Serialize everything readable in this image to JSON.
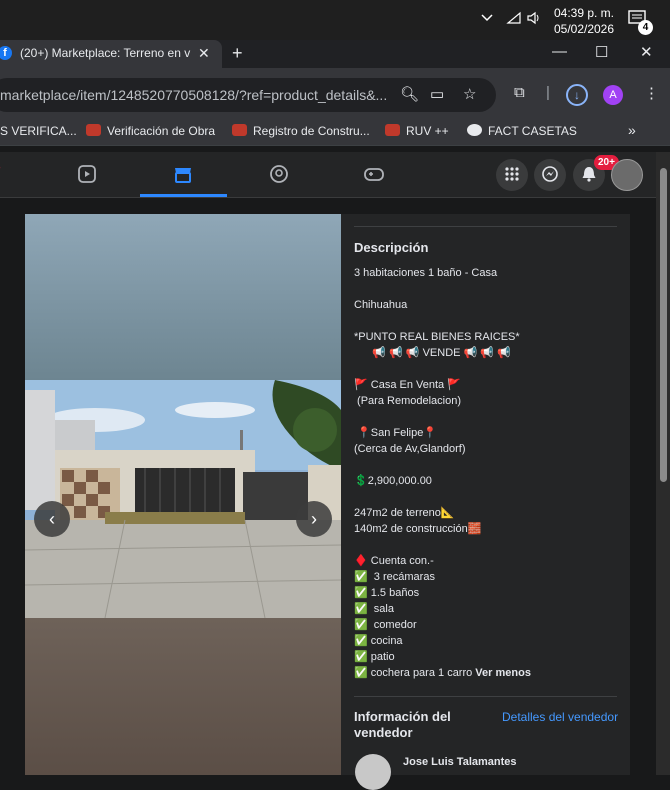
{
  "taskbar": {
    "time": "04:39 p. m.",
    "date": "05/02/2026",
    "notification_count": "4"
  },
  "browser": {
    "tab_title": "(20+) Marketplace: Terreno en v",
    "url": "marketplace/item/1248520770508128/?ref=product_details&...",
    "profile_initial": "A",
    "bookmarks": [
      "S VERIFICA...",
      "Verificación de Obra",
      "Registro de Constru...",
      "RUV ++",
      "FACT CASETAS"
    ]
  },
  "facebook": {
    "notification_badge": "20+"
  },
  "listing": {
    "description_title": "Descripción",
    "description_lines": [
      "3 habitaciones 1 baño - Casa",
      "",
      "Chihuahua",
      "",
      "*PUNTO REAL BIENES RAICES*",
      "      📢 📢 📢 VENDE 📢 📢 📢",
      "",
      "🚩 Casa En Venta 🚩",
      " (Para Remodelacion)",
      "",
      " 📍San Felipe📍",
      "(Cerca de Av,Glandorf)",
      "",
      "💲2,900,000.00",
      "",
      "247m2 de terreno📐",
      "140m2 de construcción🧱",
      "",
      "♦️ Cuenta con.-",
      "✅  3 recámaras",
      "✅ 1.5 baños",
      "✅  sala",
      "✅  comedor",
      "✅ cocina",
      "✅ patio",
      "✅ cochera para 1 carro"
    ],
    "see_less": "Ver menos",
    "seller_section_title": "Información del vendedor",
    "seller_details_link": "Detalles del vendedor",
    "seller_name": "Jose Luis Talamantes"
  }
}
